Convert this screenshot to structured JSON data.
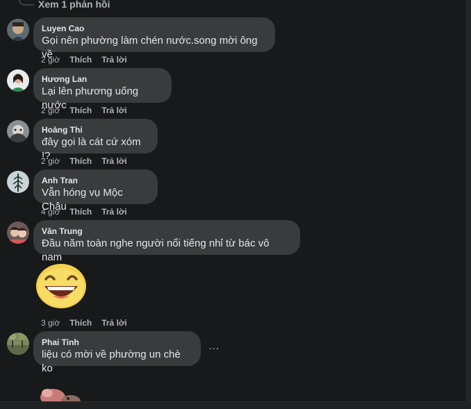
{
  "top_reply": {
    "label": "Xem 1 phản hồi"
  },
  "comments": [
    {
      "name": "Luyen Cao",
      "text": "Gọi nên phường làm chén nước.song mời ông về",
      "time": "2 giờ",
      "like": "Thích",
      "reply": "Trả lời"
    },
    {
      "name": "Hương Lan",
      "text": "Lại lên phương uống nước",
      "time": "2 giờ",
      "like": "Thích",
      "reply": "Trả lời"
    },
    {
      "name": "Hoàng Thi",
      "text": "đây gọi là cát cứ xóm !?",
      "time": "2 giờ",
      "like": "Thích",
      "reply": "Trả lời"
    },
    {
      "name": "Anh Tran",
      "text": "Vẫn hóng vụ Mộc Châu",
      "time": "4 giờ",
      "like": "Thích",
      "reply": "Trả lời"
    },
    {
      "name": "Văn Trung",
      "text": "Đầu năm toàn nghe người nổi tiếng nhỉ từ bác vô nam",
      "time": "3 giờ",
      "like": "Thích",
      "reply": "Trả lời"
    },
    {
      "name": "Phai Tinh",
      "text": "liệu có mời về phường un chè ko",
      "more": "…"
    }
  ],
  "colors": {
    "background": "#18191a",
    "bubble": "#3a3b3c",
    "text": "#e4e6eb",
    "secondary": "#b0b3b8",
    "emoji": "#f5d04c"
  }
}
